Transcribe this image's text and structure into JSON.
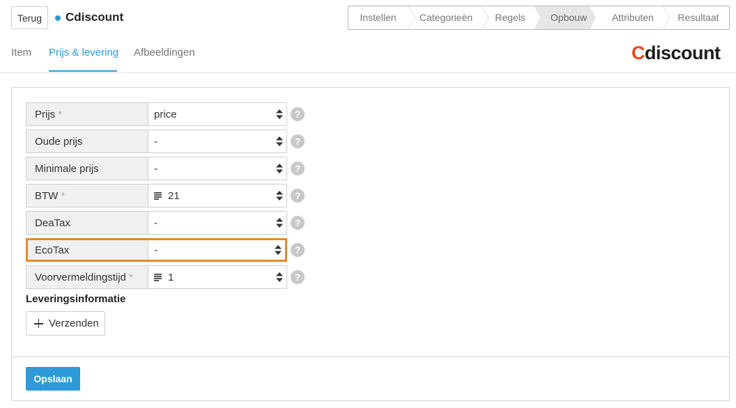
{
  "header": {
    "back_label": "Terug",
    "title": "Cdiscount",
    "status_dot_color": "#2e9ad9"
  },
  "steps": [
    {
      "label": "Instellen",
      "active": false
    },
    {
      "label": "Categorieën",
      "active": false
    },
    {
      "label": "Regels",
      "active": false
    },
    {
      "label": "Opbouw",
      "active": true
    },
    {
      "label": "Attributen",
      "active": false
    },
    {
      "label": "Resultaat",
      "active": false
    }
  ],
  "tabs": [
    {
      "label": "Item",
      "active": false
    },
    {
      "label": "Prijs & levering",
      "active": true
    },
    {
      "label": "Afbeeldingen",
      "active": false
    }
  ],
  "logo": {
    "first_letter": "C",
    "rest": "discount",
    "accent_color": "#e8481f"
  },
  "fields": [
    {
      "label": "Prijs",
      "required": "*",
      "value": "price",
      "icon": "",
      "highlight": false
    },
    {
      "label": "Oude prijs",
      "required": "",
      "value": "-",
      "icon": "",
      "highlight": false
    },
    {
      "label": "Minimale prijs",
      "required": "",
      "value": "-",
      "icon": "",
      "highlight": false
    },
    {
      "label": "BTW",
      "required": "*",
      "value": "21",
      "icon": "text-lines-icon",
      "highlight": false
    },
    {
      "label": "DeaTax",
      "required": "",
      "value": "-",
      "icon": "",
      "highlight": false
    },
    {
      "label": "EcoTax",
      "required": "",
      "value": "-",
      "icon": "",
      "highlight": true
    },
    {
      "label": "Voorvermeldingstijd",
      "required": "*",
      "value": "1",
      "icon": "text-lines-icon",
      "highlight": false
    }
  ],
  "help_glyph": "?",
  "delivery": {
    "heading": "Leveringsinformatie",
    "send_label": "Verzenden"
  },
  "save_label": "Opslaan",
  "colors": {
    "accent": "#2e9ad9",
    "highlight": "#e38a2b"
  }
}
